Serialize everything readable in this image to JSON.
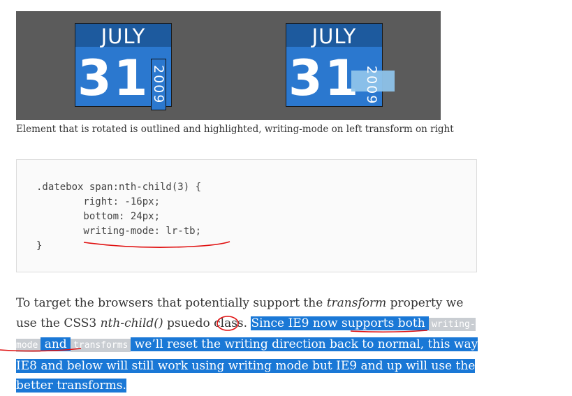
{
  "demo": {
    "left_box": {
      "month": "JULY",
      "day": "31",
      "year": "2009"
    },
    "right_box": {
      "month": "JULY",
      "day": "31",
      "year": "2009"
    }
  },
  "caption": "Element that is rotated is outlined and highlighted, writing-mode on left transform on right",
  "code": {
    "lines": [
      ".datebox span:nth-child(3) {",
      "        right: -16px;",
      "        bottom: 24px;",
      "        writing-mode: lr-tb;",
      "}"
    ]
  },
  "paragraph": {
    "t1": "To target the browsers that potentially support the ",
    "t2": "transform",
    "t3": " property we use the CSS3 ",
    "t4": "nth-child()",
    "t5": " psuedo class.",
    "t6": " ",
    "s1": "Since IE9 now supports both ",
    "s2": "writing-mode",
    "s3": " and ",
    "s4": "transforms",
    "s5": " we’ll reset the writing direction back to normal, this way IE8 and below will still work using writing mode but IE9 and up will use the better transforms."
  },
  "colors": {
    "selection": "#1a78d6",
    "annotation": "#e01010",
    "date_blue": "#2b78cf",
    "month_band": "#1d5a9e"
  }
}
